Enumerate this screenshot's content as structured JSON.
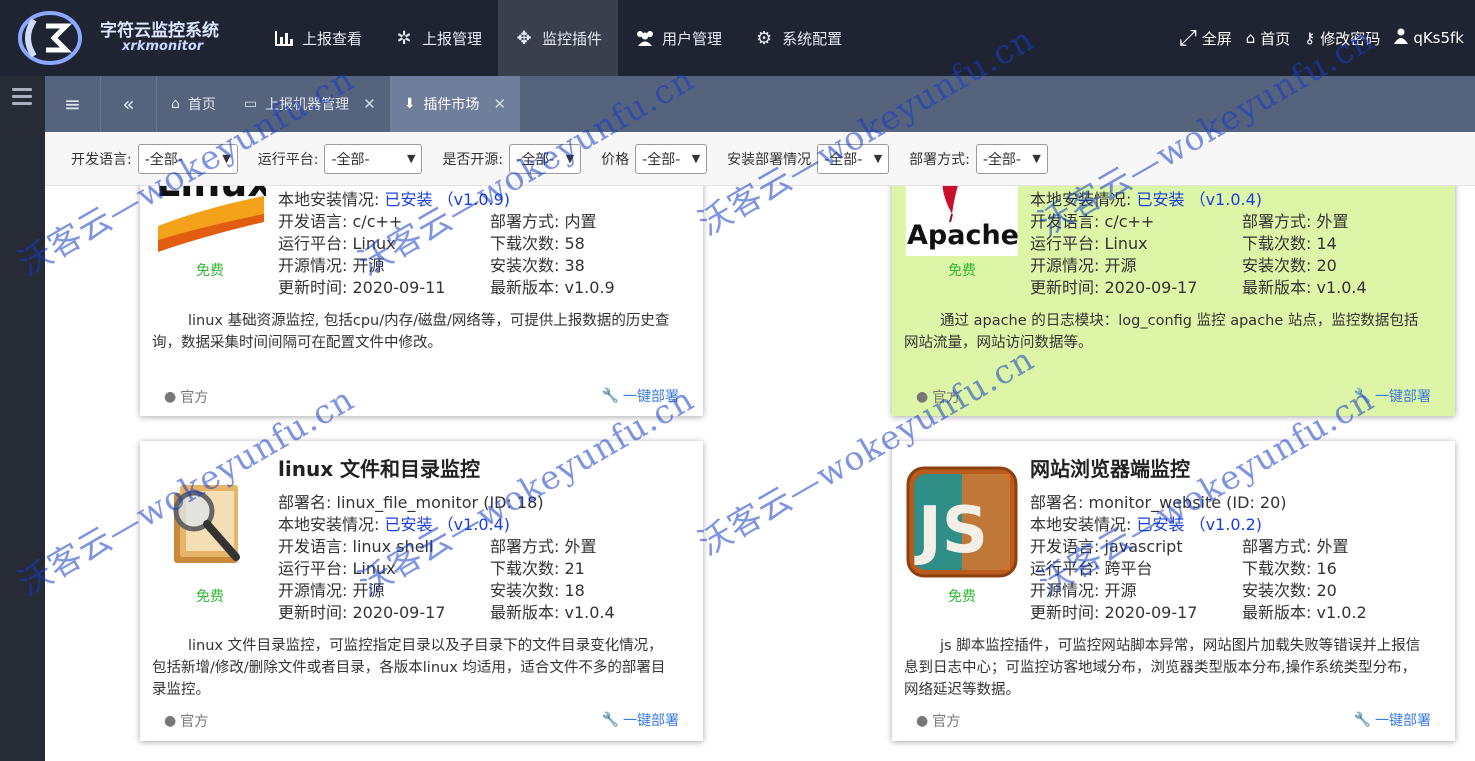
{
  "app": {
    "title": "字符云监控系统",
    "subtitle": "xrkmonitor"
  },
  "nav": [
    {
      "label": "上报查看",
      "icon": "bar-chart-icon"
    },
    {
      "label": "上报管理",
      "icon": "cogs-icon"
    },
    {
      "label": "监控插件",
      "icon": "move-icon"
    },
    {
      "label": "用户管理",
      "icon": "users-icon"
    },
    {
      "label": "系统配置",
      "icon": "gear-icon"
    }
  ],
  "topright": {
    "fullscreen": "全屏",
    "home": "首页",
    "change_password": "修改密码",
    "user": "qKs5fk"
  },
  "tabs": [
    {
      "label": "首页"
    },
    {
      "label": "上报机器管理"
    },
    {
      "label": "插件市场"
    }
  ],
  "filters": [
    {
      "label": "开发语言:",
      "value": "-全部-"
    },
    {
      "label": "运行平台:",
      "value": "-全部-"
    },
    {
      "label": "是否开源:",
      "value": "-全部-"
    },
    {
      "label": "价格",
      "value": "-全部-"
    },
    {
      "label": "安装部署情况",
      "value": "-全部-"
    },
    {
      "label": "部署方式:",
      "value": "-全部-"
    }
  ],
  "labels": {
    "local_install": "本地安装情况:",
    "lang": "开发语言:",
    "platform": "运行平台:",
    "opensource": "开源情况:",
    "updated": "更新时间:",
    "deploy_mode": "部署方式:",
    "downloads": "下载次数:",
    "installs": "安装次数:",
    "latest": "最新版本:",
    "deploy_name": "部署名:",
    "free": "免费",
    "official": "官方",
    "deploy_btn": "一键部署"
  },
  "cards": [
    {
      "title": "",
      "deploy_name": "",
      "install": "已安装 （v1.0.9)",
      "lang": "c/c++",
      "platform": "Linux",
      "opensource": "开源",
      "updated": "2020-09-11",
      "deploy_mode": "内置",
      "downloads": "58",
      "installs": "38",
      "latest": "v1.0.9",
      "desc": "linux 基础资源监控, 包括cpu/内存/磁盘/网络等，可提供上报数据的历史查询，数据采集时间间隔可在配置文件中修改。"
    },
    {
      "title": "",
      "deploy_name": "",
      "install": "已安装 （v1.0.4)",
      "lang": "c/c++",
      "platform": "Linux",
      "opensource": "开源",
      "updated": "2020-09-17",
      "deploy_mode": "外置",
      "downloads": "14",
      "installs": "20",
      "latest": "v1.0.4",
      "desc": "通过 apache 的日志模块：log_config 监控 apache 站点，监控数据包括网站流量，网站访问数据等。"
    },
    {
      "title": "linux 文件和目录监控",
      "deploy_name": "linux_file_monitor (ID: 18)",
      "install": "已安装 （v1.0.4)",
      "lang": "linux shell",
      "platform": "Linux",
      "opensource": "开源",
      "updated": "2020-09-17",
      "deploy_mode": "外置",
      "downloads": "21",
      "installs": "18",
      "latest": "v1.0.4",
      "desc": "linux 文件目录监控，可监控指定目录以及子目录下的文件目录变化情况，包括新增/修改/删除文件或者目录，各版本linux 均适用，适合文件不多的部署目录监控。"
    },
    {
      "title": "网站浏览器端监控",
      "deploy_name": "monitor_website (ID: 20)",
      "install": "已安装 （v1.0.2)",
      "lang": "javascript",
      "platform": "跨平台",
      "opensource": "开源",
      "updated": "2020-09-17",
      "deploy_mode": "外置",
      "downloads": "16",
      "installs": "20",
      "latest": "v1.0.2",
      "desc": "js 脚本监控插件，可监控网站脚本异常，网站图片加载失败等错误并上报信息到日志中心；可监控访客地域分布，浏览器类型版本分布,操作系统类型分布，网络延迟等数据。"
    }
  ],
  "card_images": {
    "c0": "Linux",
    "c1": "Apache",
    "c3": "JS"
  },
  "watermark": "沃客云—wokeyunfu.cn"
}
